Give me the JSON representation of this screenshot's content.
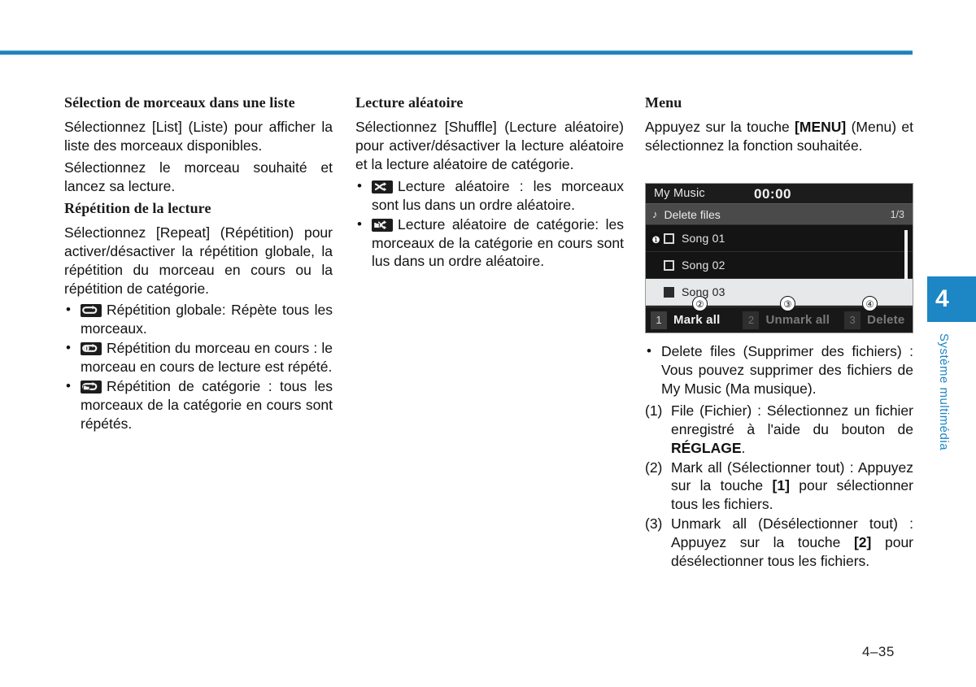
{
  "page": {
    "number": "4–35",
    "chapter_tab": {
      "number": "4",
      "label": "Système multimédia",
      "accent_color": "#1d86c4"
    },
    "rule_color": "#1f82bd"
  },
  "column1": {
    "heading1": "Sélection de morceaux dans une liste",
    "para1": "Sélectionnez [List] (Liste) pour afficher la liste des morceaux disponibles.",
    "para2": "Sélectionnez le morceau souhaité et lancez sa lecture.",
    "heading2": "Répétition de la lecture",
    "para3": "Sélectionnez [Repeat] (Répétition) pour activer/désactiver la répétition globale, la répétition du morceau en cours ou la répétition de catégorie.",
    "bullets": [
      {
        "icon": "repeat-all-icon",
        "text": "Répétition globale: Répète tous les morceaux."
      },
      {
        "icon": "repeat-one-icon",
        "text": "Répétition du morceau en cours : le morceau en cours de lecture est répété."
      },
      {
        "icon": "repeat-folder-icon",
        "text": "Répétition de catégorie : tous les morceaux de la catégorie en cours sont répétés."
      }
    ]
  },
  "column2": {
    "heading1": "Lecture aléatoire",
    "para1": "Sélectionnez [Shuffle] (Lecture aléatoire) pour activer/désactiver la lecture aléatoire et la lecture aléatoire de catégorie.",
    "bullets": [
      {
        "icon": "shuffle-icon",
        "text": "Lecture aléatoire : les morceaux sont lus dans un ordre aléatoire."
      },
      {
        "icon": "shuffle-folder-icon",
        "text": "Lecture aléatoire de catégorie: les morceaux de la catégorie en cours sont lus dans un ordre aléatoire."
      }
    ]
  },
  "column3": {
    "heading1": "Menu",
    "para1_part1": "Appuyez sur la touche ",
    "para1_bold": "[MENU]",
    "para1_part2": " (Menu) et sélectionnez la fonction souhaitée.",
    "bullets": [
      {
        "text": "Delete files (Supprimer des fichiers) : Vous pouvez supprimer des fichiers de My Music (Ma musique)."
      }
    ],
    "numbered": [
      {
        "marker": "(1)",
        "part1": "File (Fichier) : Sélectionnez un fichier enregistré à l'aide du bouton de ",
        "bold": "RÉGLAGE",
        "part2": "."
      },
      {
        "marker": "(2)",
        "part1": "Mark all (Sélectionner tout) : Appuyez sur la touche ",
        "bold": "[1]",
        "part2": " pour sélectionner tous les fichiers."
      },
      {
        "marker": "(3)",
        "part1": "Unmark all (Désélectionner tout) : Appuyez sur la touche ",
        "bold": "[2]",
        "part2": " pour désélectionner tous les fichiers."
      }
    ]
  },
  "device_screen": {
    "title": "My Music",
    "clock": "00:00",
    "subheader": {
      "icon": "music-note-icon",
      "label": "Delete files",
      "page_indicator": "1/3"
    },
    "rows": [
      {
        "label": "Song 01",
        "checked": false,
        "selected": false
      },
      {
        "label": "Song 02",
        "checked": false,
        "selected": false
      },
      {
        "label": "Song 03",
        "checked": true,
        "selected": true
      }
    ],
    "footer_buttons": [
      {
        "key": "1",
        "label": "Mark all",
        "enabled": true
      },
      {
        "key": "2",
        "label": "Unmark all",
        "enabled": false
      },
      {
        "key": "3",
        "label": "Delete",
        "enabled": false
      }
    ],
    "callouts": [
      {
        "number": "❶",
        "style": "filled"
      },
      {
        "number": "②",
        "style": "outlined"
      },
      {
        "number": "③",
        "style": "outlined"
      },
      {
        "number": "④",
        "style": "outlined"
      }
    ]
  }
}
